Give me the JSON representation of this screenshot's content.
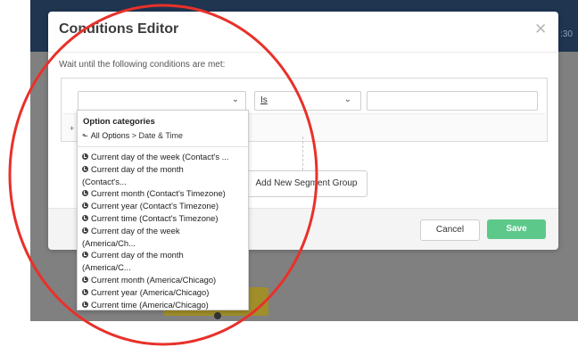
{
  "background": {
    "time_fragment": ":30"
  },
  "modal": {
    "title": "Conditions Editor",
    "close_icon": "close-icon",
    "prompt": "Wait until the following conditions are met:",
    "condition": {
      "field_value": "",
      "operator_value": "Is",
      "value_input": ""
    },
    "add_condition_label": "+",
    "segment_group_button": "Add New Segment Group",
    "footer": {
      "cancel_label": "Cancel",
      "save_label": "Save"
    },
    "save_color": "#5cc98a"
  },
  "dropdown": {
    "header": "Option categories",
    "breadcrumb": {
      "back_icon": "back-arrow-icon",
      "all_label": "All Options",
      "separator": ">",
      "current": "Date & Time"
    },
    "options": [
      {
        "line1": "Current day of the week (Contact's ...",
        "line2": ""
      },
      {
        "line1": "Current day of the month",
        "line2": "(Contact's..."
      },
      {
        "line1": "Current month (Contact's Timezone)",
        "line2": ""
      },
      {
        "line1": "Current year (Contact's Timezone)",
        "line2": ""
      },
      {
        "line1": "Current time (Contact's Timezone)",
        "line2": ""
      },
      {
        "line1": "Current day of the week",
        "line2": "(America/Ch..."
      },
      {
        "line1": "Current day of the month",
        "line2": "(America/C..."
      },
      {
        "line1": "Current month (America/Chicago)",
        "line2": ""
      },
      {
        "line1": "Current year (America/Chicago)",
        "line2": ""
      },
      {
        "line1": "Current time (America/Chicago)",
        "line2": ""
      }
    ]
  }
}
